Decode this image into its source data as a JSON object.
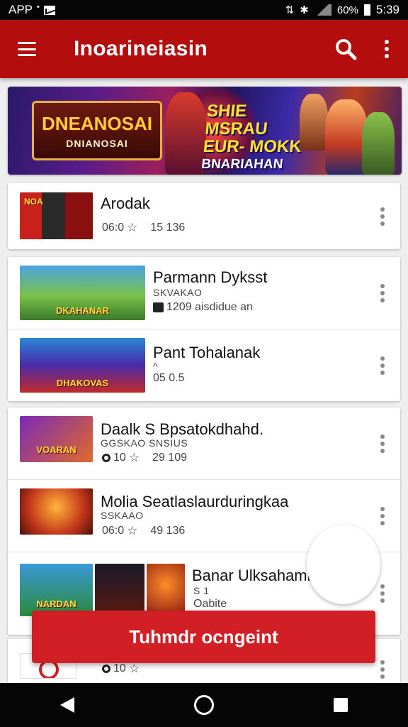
{
  "status_bar": {
    "left_text": "APP",
    "battery": "60%",
    "time": "5:39"
  },
  "app_bar": {
    "title": "Inoarineiasin",
    "menu_icon": "hamburger-menu-icon",
    "search_icon": "search-icon",
    "more_icon": "more-vert-icon"
  },
  "banner": {
    "logo_line1": "DNEANOSAI",
    "logo_line2": "DNIANOSAI",
    "tagline1": "SHIE MSRAU",
    "tagline2": "EUR- MOKK",
    "tagline3": "BNARIAHAN"
  },
  "list": [
    {
      "thumb_text": "NOA",
      "title": "Arodak",
      "sub": "",
      "meta_left": "06:0",
      "meta_right": "15 136"
    },
    {
      "thumb_text": "DKAHANAR",
      "title": "Parmann Dyksst",
      "sub": "SKVAKAO",
      "meta_left": "",
      "meta_right": "1209 aisdidue an"
    },
    {
      "thumb_text": "DHAKOVAS",
      "title": "Pant Tohalanak",
      "sub": "^",
      "meta_left": "05 0.5",
      "meta_right": ""
    },
    {
      "thumb_text": "VOARAN",
      "title": "Daalk S Bpsatokdhahd.",
      "sub": "GGSKAO SNSIUS",
      "meta_left": "10",
      "meta_right": "29 109"
    },
    {
      "thumb_text": "",
      "title": "Molia Seatlaslaurduringkaa",
      "sub": "SSKAAO",
      "meta_left": "06:0",
      "meta_right": "49 136"
    },
    {
      "thumb_text": "NARDAN",
      "title": "Banar Ulksahamk",
      "sub": "S 1",
      "meta_left": "Oabite",
      "meta_right": ""
    },
    {
      "thumb_text": "",
      "title": "",
      "sub": "",
      "meta_left": "10",
      "meta_right": ""
    }
  ],
  "snackbar": {
    "label": "Tuhmdr ocngeint"
  },
  "colors": {
    "primary": "#b40d0d",
    "accent": "#d21e25"
  },
  "nav": {
    "back_icon": "back-icon",
    "home_icon": "home-icon",
    "recents_icon": "recents-icon"
  }
}
